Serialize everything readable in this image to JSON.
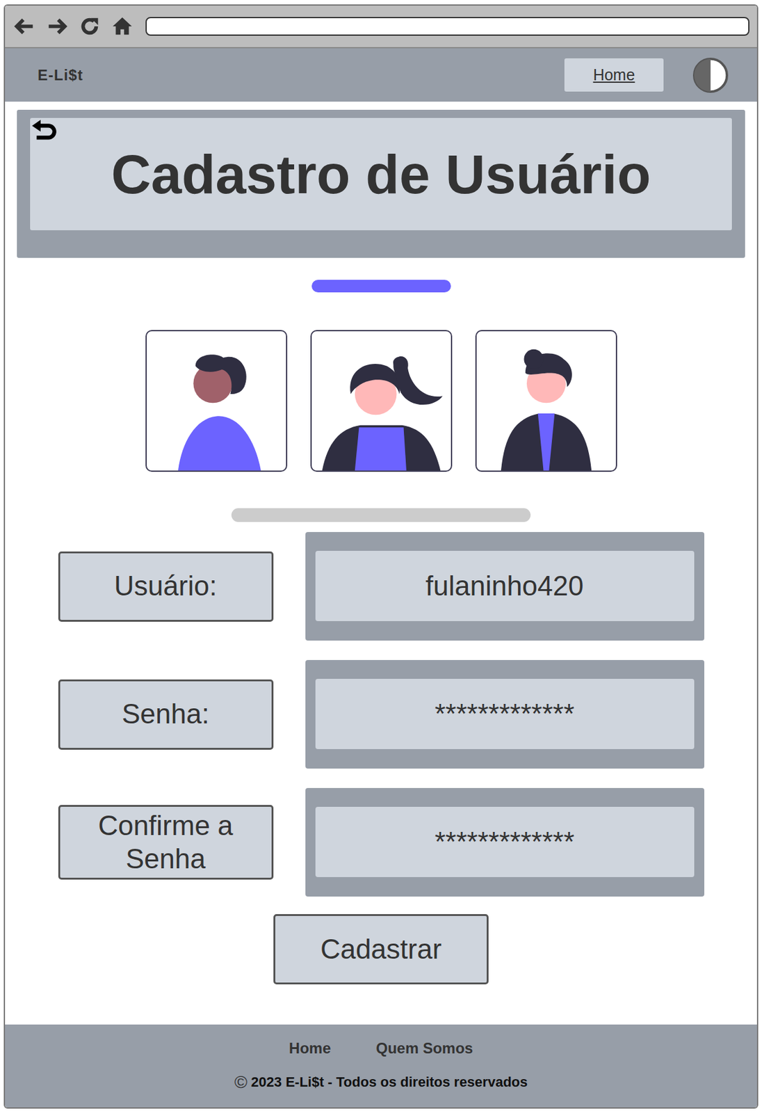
{
  "header": {
    "logo": "E-Li$t",
    "nav": [
      {
        "label": "Home",
        "selected": false
      }
    ]
  },
  "page": {
    "title": "Cadastro de Usuário"
  },
  "form": {
    "fields": [
      {
        "label": "Usuário:",
        "value": "fulaninho420"
      },
      {
        "label": "Senha:",
        "value": "*************"
      },
      {
        "label": "Confirme a Senha",
        "value": "*************"
      }
    ],
    "submit": "Cadastrar"
  },
  "footer": {
    "links": [
      "Home",
      "Quem Somos"
    ],
    "copyright_symbol": "©",
    "copyright": "2023 E-Li$t - Todos os direitos reservados"
  }
}
